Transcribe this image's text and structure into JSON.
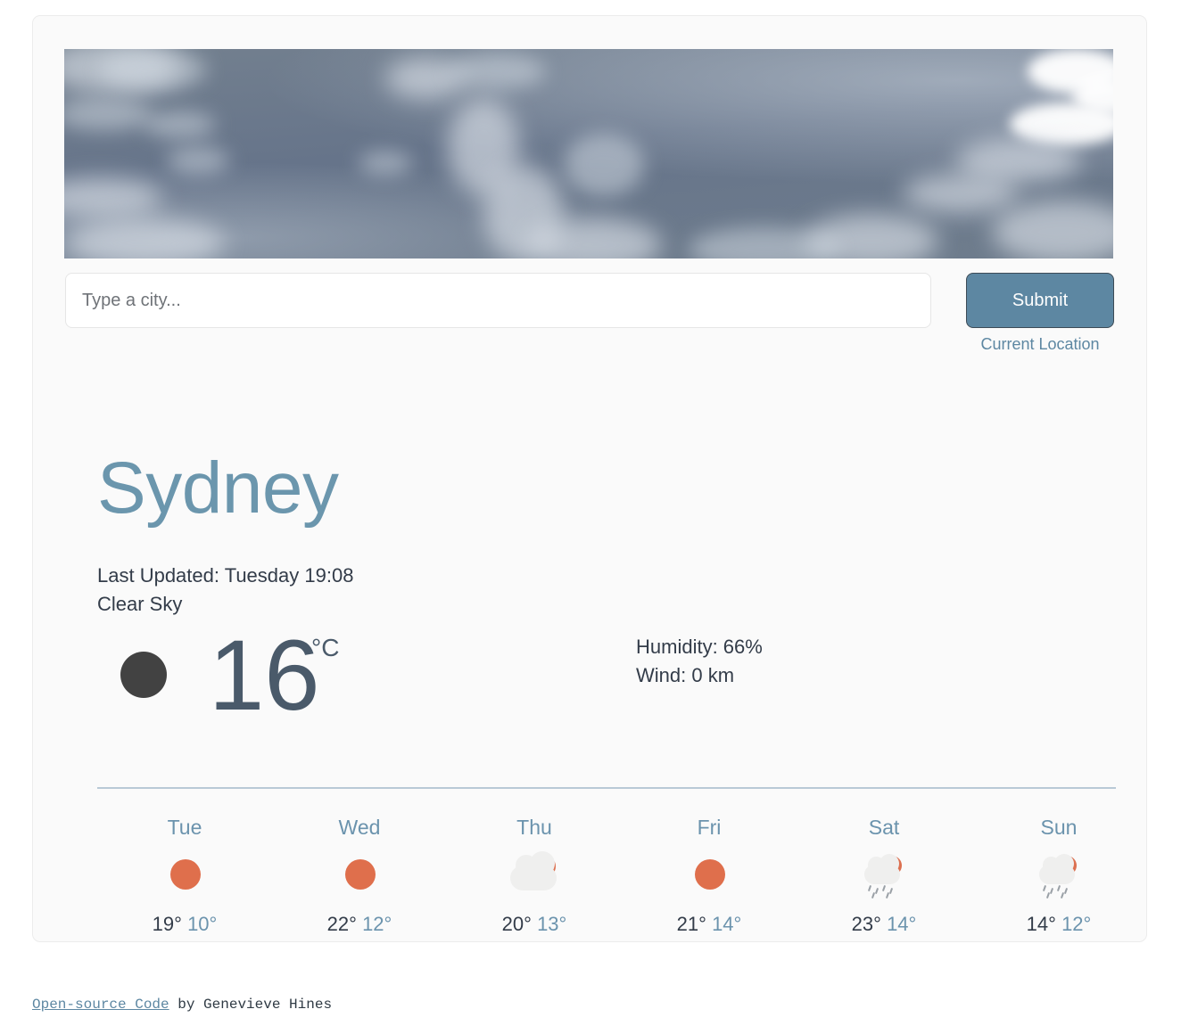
{
  "hero": {
    "alt": "sky-photo-banner"
  },
  "search": {
    "placeholder": "Type a city...",
    "value": "",
    "submit_label": "Submit",
    "current_location_label": "Current Location"
  },
  "current": {
    "city": "Sydney",
    "last_updated": "Last Updated: Tuesday 19:08",
    "description": "Clear Sky",
    "temperature": "16",
    "unit": "°C",
    "icon": "broken-image-circle",
    "humidity": "Humidity: 66%",
    "wind": "Wind: 0 km"
  },
  "forecast": [
    {
      "day": "Tue",
      "icon": "sun-icon",
      "high": "19°",
      "low": "10°"
    },
    {
      "day": "Wed",
      "icon": "sun-icon",
      "high": "22°",
      "low": "12°"
    },
    {
      "day": "Thu",
      "icon": "cloud-sun-icon",
      "high": "20°",
      "low": "13°"
    },
    {
      "day": "Fri",
      "icon": "sun-icon",
      "high": "21°",
      "low": "14°"
    },
    {
      "day": "Sat",
      "icon": "rain-sun-icon",
      "high": "23°",
      "low": "14°"
    },
    {
      "day": "Sun",
      "icon": "rain-sun-icon",
      "high": "14°",
      "low": "12°"
    }
  ],
  "footer": {
    "link_label": "Open-source Code",
    "credit": " by Genevieve Hines"
  },
  "colors": {
    "accent": "#5d87a2",
    "city_title": "#6b96ad",
    "text": "#333c49",
    "temp": "#4a5a6a",
    "sun": "#df6f4c",
    "cloud": "#efefee",
    "divider": "#b9c9d6",
    "card_bg": "#fafafa"
  }
}
